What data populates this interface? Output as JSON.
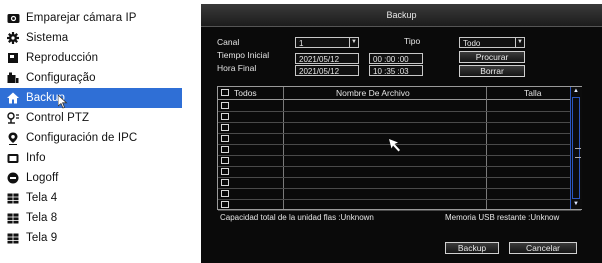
{
  "menu": {
    "items": [
      {
        "label": "Emparejar cámara IP",
        "icon": "camera-icon"
      },
      {
        "label": "Sistema",
        "icon": "gear-icon"
      },
      {
        "label": "Reproducción",
        "icon": "playback-icon"
      },
      {
        "label": "Configuração",
        "icon": "config-icon"
      },
      {
        "label": "Backup",
        "icon": "home-icon",
        "active": true
      },
      {
        "label": "Control PTZ",
        "icon": "ptz-icon"
      },
      {
        "label": "Configuración de IPC",
        "icon": "location-icon"
      },
      {
        "label": "Info",
        "icon": "info-icon"
      },
      {
        "label": "Logoff",
        "icon": "power-icon"
      },
      {
        "label": "Tela 4",
        "icon": "grid-icon"
      },
      {
        "label": "Tela 8",
        "icon": "grid-icon"
      },
      {
        "label": "Tela 9",
        "icon": "grid-icon"
      }
    ],
    "accent_color": "#2f6fd6"
  },
  "dialog": {
    "title": "Backup",
    "canal_label": "Canal",
    "canal_value": "1",
    "tipo_label": "Tipo",
    "tipo_value": "Todo",
    "tiempo_inicial_label": "Tiempo Inicial",
    "fecha_inicial": "2021/05/12",
    "hora_inicial": "00 :00 :00",
    "hora_final_label": "Hora Final",
    "fecha_final": "2021/05/12",
    "hora_final": "10 :35 :03",
    "procurar_label": "Procurar",
    "borrar_label": "Borrar",
    "table": {
      "columns": [
        "Todos",
        "Nombre De Archivo",
        "Talla"
      ],
      "row_count": 10
    },
    "capacity_text": "Capacidad total de la unidad flas :Unknown",
    "usb_text": "Memoria USB restante :Unknow",
    "backup_button": "Backup",
    "cancel_button": "Cancelar"
  }
}
